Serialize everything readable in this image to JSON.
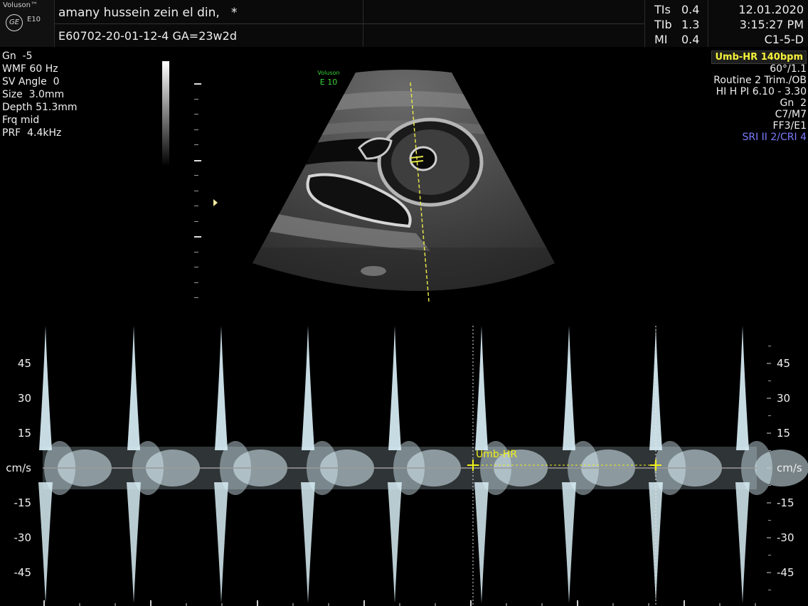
{
  "brand": {
    "name": "Voluson™",
    "logo": "GE",
    "model": "E10"
  },
  "header": {
    "patient_name": "amany hussein zein el din,   *",
    "patient_id": "E60702-20-01-12-4   GA=23w2d",
    "indices": [
      {
        "label": "TIs",
        "value": "0.4"
      },
      {
        "label": "TIb",
        "value": "1.3"
      },
      {
        "label": "MI",
        "value": "0.4"
      }
    ],
    "date": "12.01.2020",
    "time": "3:15:27 PM",
    "probe": "C1-5-D"
  },
  "left_params": [
    "Gn  -5",
    "WMF 60 Hz",
    "SV Angle  0",
    "Size  3.0mm",
    "Depth 51.3mm",
    "Frq mid",
    "PRF  4.4kHz"
  ],
  "right_params": {
    "measurement_badge": "Umb-HR 140bpm",
    "lines": [
      "60°/1.1",
      "Routine 2 Trim./OB",
      "HI H PI 6.10 - 3.30",
      "Gn  2",
      "C7/M7",
      "FF3/E1"
    ],
    "sri": "SRI II 2/CRI 4"
  },
  "sector_brand": {
    "name": "Voluson",
    "model": "E 10"
  },
  "doppler": {
    "unit": "cm/s",
    "axis_values": [
      "45",
      "30",
      "15",
      "cm/s",
      "-15",
      "-30",
      "-45"
    ],
    "measure_label": "Umb-HR",
    "colors": {
      "caliper": "#f0f01a",
      "spectrum": "#d8eef6",
      "baseline": "#9a9a9a"
    }
  }
}
